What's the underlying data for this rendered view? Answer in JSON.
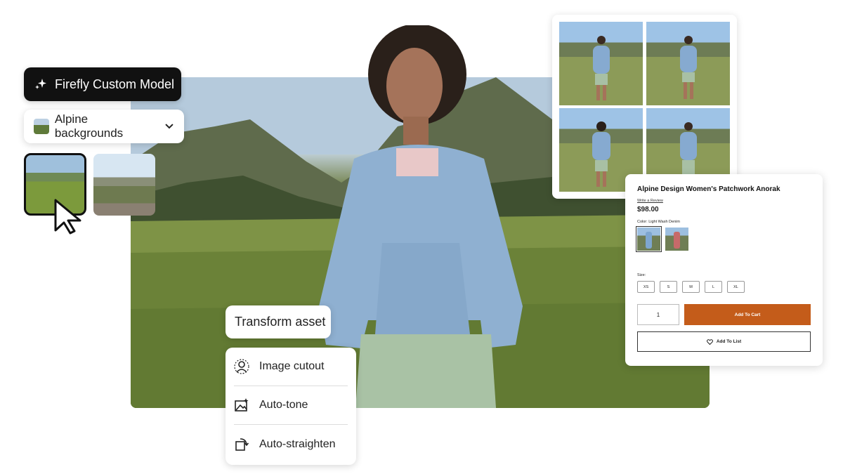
{
  "model_button": {
    "label": "Firefly Custom Model",
    "icon": "sparkle-icon"
  },
  "style_select": {
    "value": "Alpine backgrounds",
    "icon": "chevron-down-icon"
  },
  "transform": {
    "label": "Transform asset"
  },
  "menu": {
    "items": [
      {
        "label": "Image cutout",
        "icon": "image-cutout-icon"
      },
      {
        "label": "Auto-tone",
        "icon": "auto-tone-icon"
      },
      {
        "label": "Auto-straighten",
        "icon": "auto-straighten-icon"
      }
    ]
  },
  "product": {
    "title": "Alpine Design Women's Patchwork Anorak",
    "review_link": "Write a Review",
    "price": "$98.00",
    "color_label": "Color: Light Wash Denim",
    "size_label": "Size:",
    "sizes": [
      "XS",
      "S",
      "M",
      "L",
      "XL"
    ],
    "quantity": "1",
    "add_to_cart": "Add To Cart",
    "add_to_list": "Add To List",
    "accent_color": "#c45c1a"
  }
}
